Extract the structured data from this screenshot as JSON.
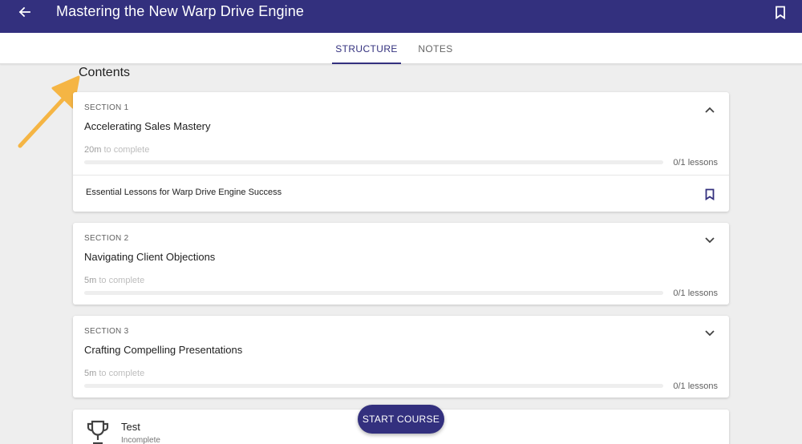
{
  "colors": {
    "primary": "#33307e",
    "background": "#eeeeee",
    "annotation_arrow": "#f5b544"
  },
  "header": {
    "title": "Mastering the New Warp Drive Engine",
    "back_icon": "arrow-left-icon",
    "bookmark_icon": "bookmark-outline-icon"
  },
  "tabs": [
    {
      "label": "STRUCTURE",
      "active": true
    },
    {
      "label": "NOTES",
      "active": false
    }
  ],
  "contents_title": "Contents",
  "sections": [
    {
      "label": "SECTION 1",
      "title": "Accelerating Sales Mastery",
      "duration_value": "20m",
      "duration_suffix": " to complete",
      "progress": 0,
      "lessons_text": "0/1 lessons",
      "expanded": true,
      "chevron_icon": "chevron-up-icon",
      "lessons": [
        {
          "title": "Essential Lessons for Warp Drive Engine Success",
          "icon": "bookmark-outline-icon"
        }
      ]
    },
    {
      "label": "SECTION 2",
      "title": "Navigating Client Objections",
      "duration_value": "5m",
      "duration_suffix": " to complete",
      "progress": 0,
      "lessons_text": "0/1 lessons",
      "expanded": false,
      "chevron_icon": "chevron-down-icon"
    },
    {
      "label": "SECTION 3",
      "title": "Crafting Compelling Presentations",
      "duration_value": "5m",
      "duration_suffix": " to complete",
      "progress": 0,
      "lessons_text": "0/1 lessons",
      "expanded": false,
      "chevron_icon": "chevron-down-icon"
    }
  ],
  "test": {
    "title": "Test",
    "status": "Incomplete",
    "icon": "trophy-icon"
  },
  "start_button": {
    "label": "START COURSE"
  }
}
